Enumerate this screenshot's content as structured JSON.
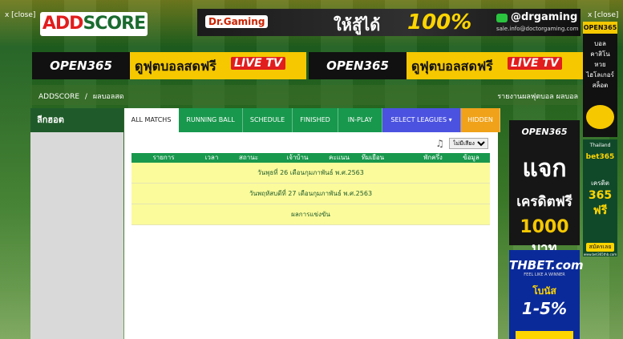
{
  "close_left": "x [close]",
  "close_right": "x [close]",
  "logo": {
    "part1": "ADD",
    "part2": "SCORE"
  },
  "top_ad": {
    "brand": "Dr.Gaming",
    "thai_text": "ให้สู้ได้",
    "percent": "100%",
    "line_id": "@drgaming",
    "email": "sale.info@doctorgaming.com"
  },
  "banners": [
    {
      "brand": "OPEN365",
      "text": "ดูฟุตบอลสดฟรี",
      "tv": "LIVE TV"
    },
    {
      "brand": "OPEN365",
      "text": "ดูฟุตบอลสดฟรี",
      "tv": "LIVE TV"
    }
  ],
  "side_ad_top": {
    "brand": "OPEN365",
    "lines": "บอล\nคาสิโน\nหวย\nไฮโลเกอร์\nสล็อต"
  },
  "side_ad_bet": {
    "country": "Thailand",
    "brand": "bet365",
    "text": "เครดิต",
    "amount": "365 ฟรี",
    "cta": "สมัครเลย",
    "url": "www.bet365thb.com"
  },
  "breadcrumb": {
    "home": "ADDSCORE",
    "sep": "/",
    "current": "ผลบอลสด"
  },
  "right_link": "รายงานผลฟุตบอล ผลบอล",
  "left_panel": {
    "title": "ลีกฮอต"
  },
  "tabs": [
    {
      "label": "ALL MATCHS"
    },
    {
      "label": "RUNNING BALL"
    },
    {
      "label": "SCHEDULE"
    },
    {
      "label": "FINISHED"
    },
    {
      "label": "IN-PLAY"
    },
    {
      "label": "SELECT LEAGUES ▾"
    },
    {
      "label": "HIDDEN"
    }
  ],
  "sound_select": {
    "value": "ไม่มีเสียง"
  },
  "table_headers": [
    "รายการ",
    "เวลา",
    "สถานะ",
    "เจ้าบ้าน",
    "คะแนน",
    "ทีมเยือน",
    "",
    "พักครึ่ง",
    "ข้อมูล"
  ],
  "rows": [
    {
      "text": "วันพุธที่ 26 เดือนกุมภาพันธ์ พ.ศ.2563"
    },
    {
      "text": "วันพฤหัสบดีที่ 27 เดือนกุมภาพันธ์ พ.ศ.2563"
    },
    {
      "text": "ผลการแข่งขัน"
    }
  ],
  "ad_right_1": {
    "brand": "OPEN365",
    "line1": "แจก",
    "line2": "เครดิตฟรี",
    "amount": "1000",
    "unit": "บาท"
  },
  "ad_right_2": {
    "brand": "THBET.com",
    "slogan": "FEEL LIKE A WINNER",
    "line1": "โบนัส",
    "line2": "1-5%"
  }
}
